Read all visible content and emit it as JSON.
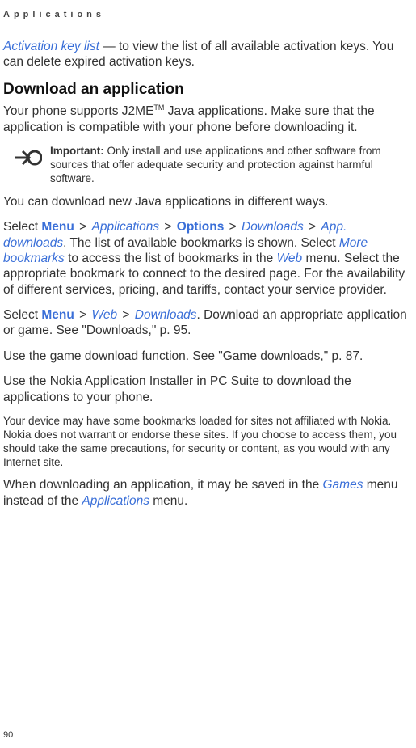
{
  "header": "Applications",
  "page_number": "90",
  "p1": {
    "seg1": "Activation key list",
    "seg2": " — to view the list of all available activation keys. You can delete expired activation keys."
  },
  "section_title": "Download an application",
  "p2": {
    "seg1": "Your phone supports J2ME",
    "tm": "TM",
    "seg2": " Java applications. Make sure that the application is compatible with your phone before downloading it."
  },
  "note": {
    "label": "Important:",
    "text": " Only install and use applications and other software from sources that offer adequate security and protection against harmful software."
  },
  "p3": "You can download new Java applications in different ways.",
  "p4": {
    "t1": "Select ",
    "menu": "Menu",
    "gt1": " > ",
    "apps": "Applications",
    "gt2": " > ",
    "options": "Options",
    "gt3": " > ",
    "downloads": "Downloads",
    "gt4": " > ",
    "appdl": "App. downloads",
    "t2": ". The list of available bookmarks is shown. Select ",
    "morebm": "More bookmarks",
    "t3": " to access the list of bookmarks in the ",
    "web": "Web",
    "t4": " menu. Select the appropriate bookmark to connect to the desired page. For the availability of different services, pricing, and tariffs, contact your service provider."
  },
  "p5": {
    "t1": "Select ",
    "menu": "Menu",
    "gt1": " > ",
    "web": "Web",
    "gt2": " > ",
    "downloads": "Downloads",
    "t2": ". Download an appropriate application or game. See \"Downloads,\" p. 95."
  },
  "p6": "Use the game download function. See \"Game downloads,\" p. 87.",
  "p7": "Use the Nokia Application Installer in PC Suite to download the applications to your phone.",
  "p8": "Your device may have some bookmarks loaded for sites not affiliated with Nokia. Nokia does not warrant or endorse these sites. If you choose to access them, you should take the same precautions, for security or content, as you would with any Internet site.",
  "p9": {
    "t1": "When downloading an application, it may be saved in the ",
    "games": "Games",
    "t2": " menu instead of the ",
    "apps": "Applications",
    "t3": " menu."
  }
}
